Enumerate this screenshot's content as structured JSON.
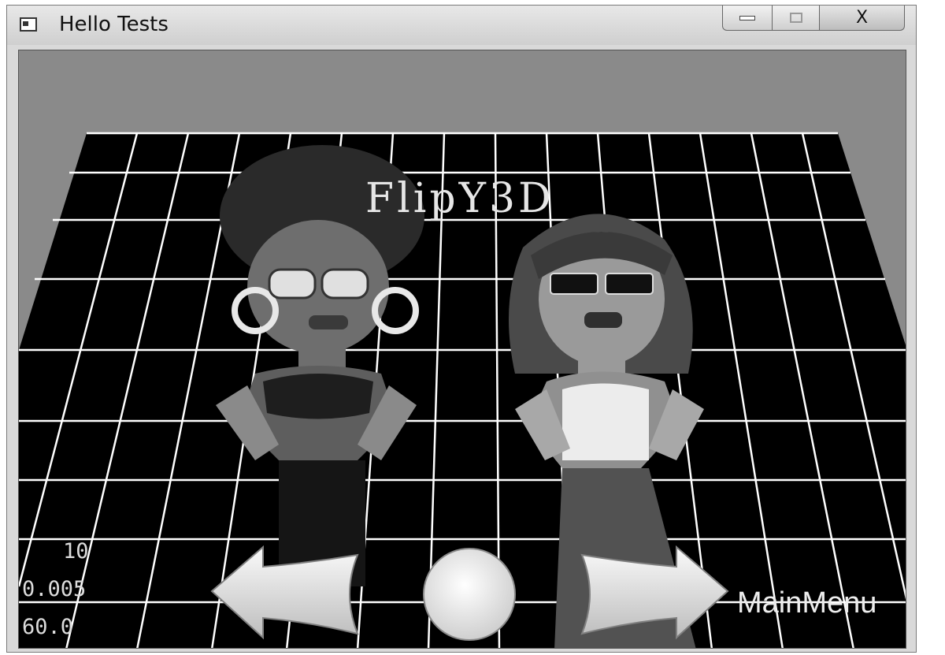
{
  "window": {
    "title": "Hello Tests",
    "controls": {
      "close_label": "X"
    }
  },
  "scene": {
    "title": "FlipY3D",
    "stats": {
      "line1": "10",
      "line2": "0.005",
      "line3": "60.0"
    },
    "menu_label": "MainMenu",
    "icons": {
      "prev": "left-arrow-icon",
      "restart": "circle-button-icon",
      "next": "right-arrow-icon"
    },
    "colors": {
      "background": "#8a8a8a",
      "floor": "#000000",
      "grid": "#ffffff"
    }
  }
}
